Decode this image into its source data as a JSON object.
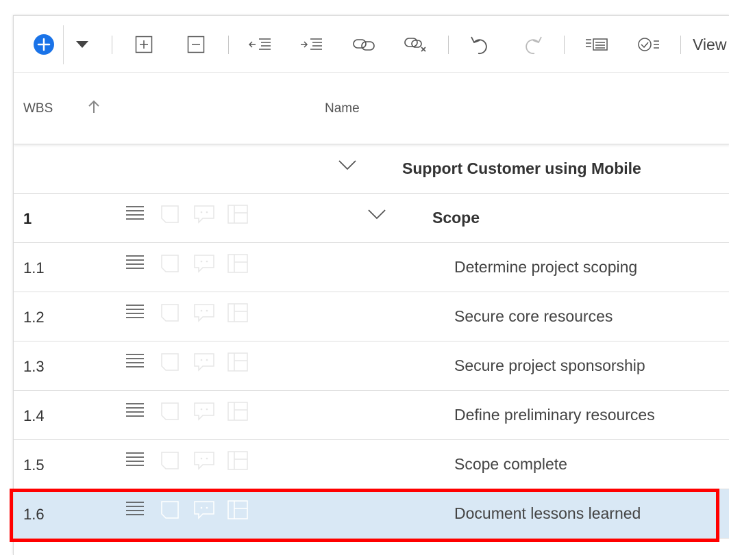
{
  "toolbar": {
    "view_label": "View",
    "icons": [
      "add-task-icon",
      "dropdown-caret-icon",
      "expand-all-icon",
      "collapse-all-icon",
      "outdent-icon",
      "indent-icon",
      "link-tasks-icon",
      "unlink-tasks-icon",
      "undo-icon",
      "redo-icon",
      "timeline-icon",
      "checklist-icon"
    ]
  },
  "columns": {
    "wbs": "WBS",
    "name": "Name"
  },
  "colors": {
    "accent": "#1a73e8",
    "selected_row": "#d9e8f5",
    "highlight_border": "#ff0000"
  },
  "rows": [
    {
      "wbs": "",
      "name": "Support Customer using Mobile",
      "level": 0,
      "bold": true,
      "collapsible": true
    },
    {
      "wbs": "1",
      "name": "Scope",
      "level": 1,
      "bold": true,
      "collapsible": true
    },
    {
      "wbs": "1.1",
      "name": "Determine project scoping",
      "level": 2
    },
    {
      "wbs": "1.2",
      "name": "Secure core resources",
      "level": 2
    },
    {
      "wbs": "1.3",
      "name": "Secure project sponsorship",
      "level": 2
    },
    {
      "wbs": "1.4",
      "name": "Define preliminary resources",
      "level": 2
    },
    {
      "wbs": "1.5",
      "name": "Scope complete",
      "level": 2
    },
    {
      "wbs": "1.6",
      "name": "Document lessons learned",
      "level": 2,
      "selected": true
    }
  ]
}
